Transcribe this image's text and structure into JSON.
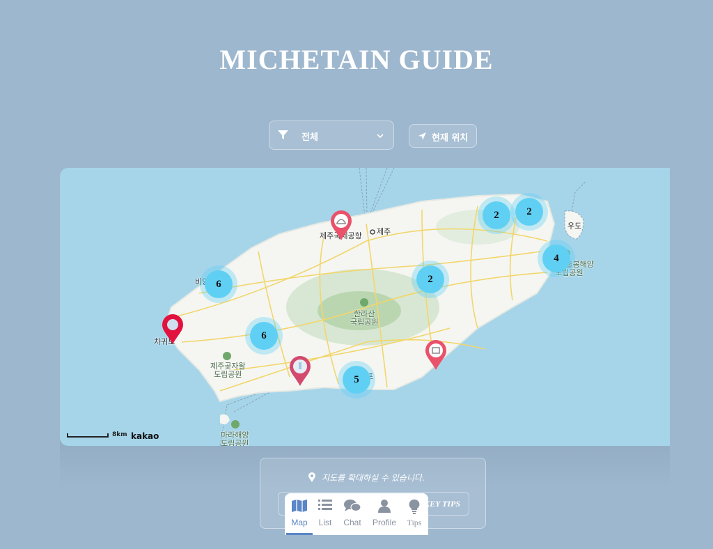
{
  "header": {
    "title": "MICHETAIN GUIDE"
  },
  "controls": {
    "filter_value": "전체",
    "location_label": "현재 위치"
  },
  "map": {
    "clusters": [
      "2",
      "2",
      "4",
      "6",
      "2",
      "6",
      "5"
    ],
    "labels": {
      "airport": "제주국제공항",
      "jeju": "제주",
      "udo": "우도",
      "seongsan": [
        "성산일출봉해양",
        "도립공원"
      ],
      "biyangdo": "비양도",
      "hallasan": [
        "한라산",
        "국립공원"
      ],
      "chagwido": "차귀도",
      "gotjawal": [
        "제주곶자왈",
        "도립공원"
      ],
      "seogwipo": "서귀포",
      "marado": [
        "마라해양",
        "도립공원"
      ]
    },
    "scale_label": "8km",
    "attribution": "kakao"
  },
  "info": {
    "hint": "지도를 확대하실 수 있습니다.",
    "tips_button": "KEY TIPS"
  },
  "tabs": [
    {
      "label": "Map",
      "icon": "map-icon",
      "active": true
    },
    {
      "label": "List",
      "icon": "list-icon"
    },
    {
      "label": "Chat",
      "icon": "chat-icon"
    },
    {
      "label": "Profile",
      "icon": "person-icon"
    },
    {
      "label": "Tips",
      "icon": "lightbulb-icon"
    }
  ],
  "colors": {
    "background": "#9db7ce",
    "sea": "#a6d5ea",
    "cluster": "#5fd0f4",
    "pin_red": "#e8334a",
    "tab_active": "#5b86c7"
  }
}
